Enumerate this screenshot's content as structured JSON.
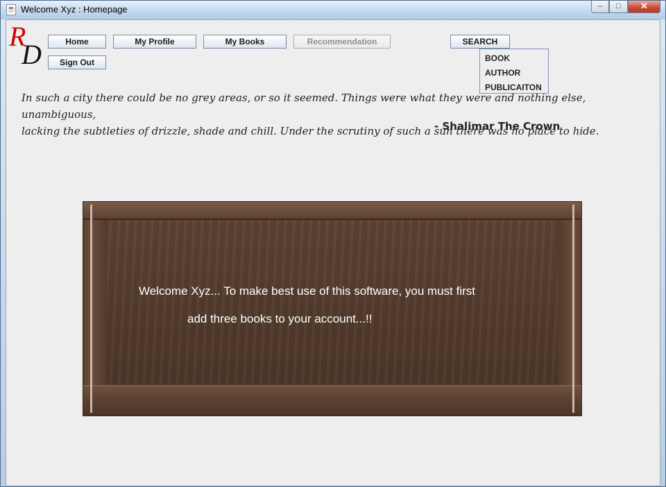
{
  "window": {
    "title": "Welcome Xyz : Homepage",
    "app_icon": "java-cup-icon",
    "controls": {
      "minimize": "–",
      "maximize": "□",
      "close": "✕"
    }
  },
  "logo": {
    "letter_top": "R",
    "letter_bottom": "D"
  },
  "nav": {
    "home": "Home",
    "my_profile": "My Profile",
    "my_books": "My Books",
    "recommendation": "Recommendation",
    "search": "SEARCH",
    "sign_out": "Sign Out"
  },
  "search_menu": {
    "items": [
      "BOOK",
      "AUTHOR",
      "PUBLICAITON"
    ]
  },
  "quote": {
    "line1": "In such a city there could be no grey areas, or so it seemed. Things were what they were and nothing else, unambiguous,",
    "line2": "lacking the subtleties of drizzle, shade and chill. Under the scrutiny of such a sun there was no place to hide.",
    "author": "- Shalimar The Crown"
  },
  "welcome": {
    "line1": "Welcome Xyz... To make best use of this software, you must first",
    "line2": "add three books to your account...!!"
  },
  "colors": {
    "logo_red": "#d40000",
    "shelf_wood": "#533b2c",
    "client_bg": "#eeeeee"
  }
}
